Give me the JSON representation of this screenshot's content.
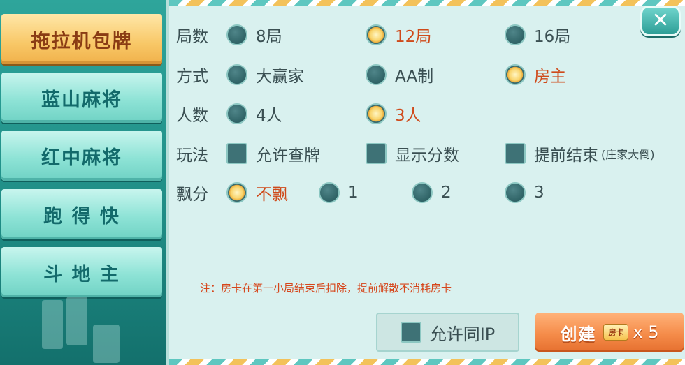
{
  "sidebar": {
    "tabs": [
      {
        "label": "拖拉机包牌",
        "active": true
      },
      {
        "label": "蓝山麻将",
        "active": false
      },
      {
        "label": "红中麻将",
        "active": false
      },
      {
        "label": "跑 得 快",
        "active": false
      },
      {
        "label": "斗 地 主",
        "active": false
      }
    ]
  },
  "options": {
    "rounds": {
      "label": "局数",
      "items": [
        "8局",
        "12局",
        "16局"
      ],
      "selected": "12局"
    },
    "mode": {
      "label": "方式",
      "items": [
        "大赢家",
        "AA制",
        "房主"
      ],
      "selected": "房主"
    },
    "players": {
      "label": "人数",
      "items": [
        "4人",
        "3人"
      ],
      "selected": "3人"
    },
    "rules": {
      "label": "玩法",
      "items": [
        "允许查牌",
        "显示分数",
        "提前结束"
      ],
      "note": "(庄家大倒)"
    },
    "float": {
      "label": "飘分",
      "items": [
        "不飘",
        "1",
        "2",
        "3"
      ],
      "selected": "不飘"
    }
  },
  "note": "注：房卡在第一小局结束后扣除，提前解散不消耗房卡",
  "footer": {
    "allow_ip_label": "允许同IP",
    "create_label": "创建",
    "card_badge": "房卡",
    "create_count": "x 5"
  },
  "close_label": "✕",
  "colors": {
    "accent": "#f58c4a",
    "selected_text": "#cf4a1a",
    "panel_bg": "#d9f1ef"
  }
}
